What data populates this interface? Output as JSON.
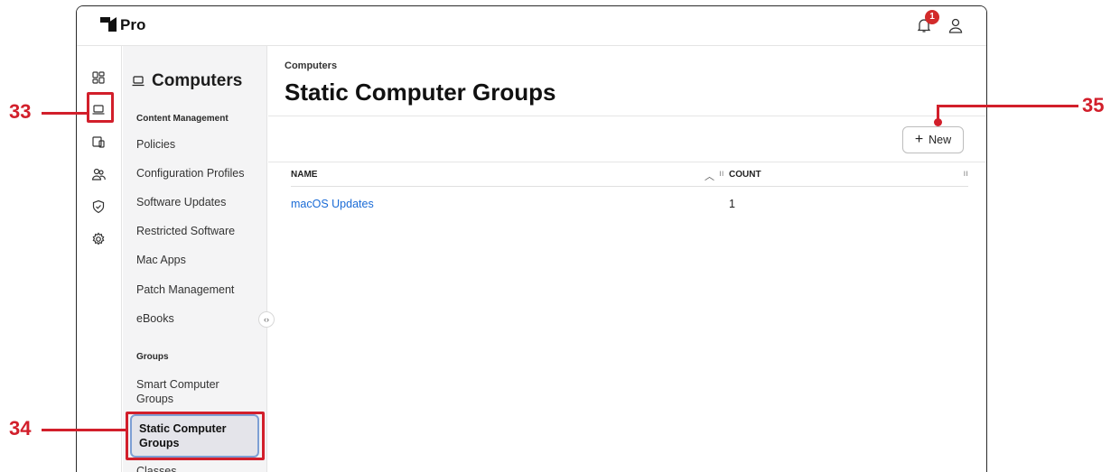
{
  "app": {
    "title": "Pro",
    "notification_count": "1"
  },
  "rail": {
    "items": [
      {
        "icon": "dashboard-icon"
      },
      {
        "icon": "laptop-icon"
      },
      {
        "icon": "devices-icon"
      },
      {
        "icon": "users-icon"
      },
      {
        "icon": "shield-icon"
      },
      {
        "icon": "gear-icon"
      }
    ]
  },
  "sidebar": {
    "title": "Computers",
    "section_content": "Content Management",
    "items": [
      {
        "label": "Policies"
      },
      {
        "label": "Configuration Profiles"
      },
      {
        "label": "Software Updates"
      },
      {
        "label": "Restricted Software"
      },
      {
        "label": "Mac Apps"
      },
      {
        "label": "Patch Management"
      },
      {
        "label": "eBooks"
      }
    ],
    "section_groups": "Groups",
    "group_items": [
      {
        "label": "Smart Computer Groups"
      },
      {
        "label": "Static Computer Groups"
      },
      {
        "label": "Classes"
      }
    ]
  },
  "main": {
    "breadcrumb": "Computers",
    "title": "Static Computer Groups",
    "new_button": "New",
    "columns": [
      "NAME",
      "COUNT"
    ],
    "rows": [
      {
        "name": "macOS Updates",
        "count": "1"
      }
    ]
  },
  "annotations": {
    "a33": "33",
    "a34": "34",
    "a35": "35"
  },
  "colors": {
    "annotation": "#d21f2b",
    "link": "#1a6bd6",
    "badge": "#d22b2b"
  }
}
